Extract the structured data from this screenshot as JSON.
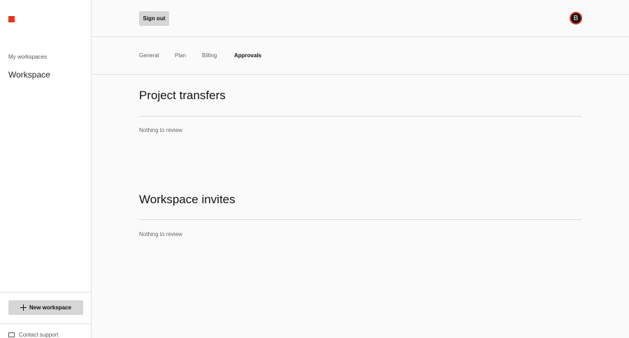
{
  "sidebar": {
    "workspaces_heading": "My workspaces",
    "workspaces": [
      {
        "label": "Workspace"
      }
    ],
    "new_workspace_label": "New workspace",
    "contact_support_label": "Contact support"
  },
  "header": {
    "sign_out_label": "Sign out",
    "avatar_initial": "B"
  },
  "tabs": [
    {
      "label": "General"
    },
    {
      "label": "Plan"
    },
    {
      "label": "Billing"
    },
    {
      "label": "Approvals",
      "active": true
    }
  ],
  "sections": [
    {
      "title": "Project transfers",
      "empty_text": "Nothing to review"
    },
    {
      "title": "Workspace invites",
      "empty_text": "Nothing to review"
    }
  ],
  "colors": {
    "brand": "#e8341c",
    "avatar_ring": "#d7341c"
  }
}
